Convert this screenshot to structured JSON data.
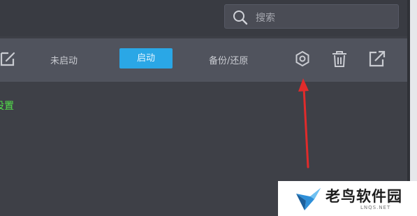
{
  "search": {
    "placeholder": "搜索"
  },
  "toolbar": {
    "edit_icon": "edit-icon",
    "not_started_label": "未启动",
    "start_label": "启动",
    "backup_restore_label": "备份/还原",
    "settings_icon": "gear-icon",
    "delete_icon": "trash-icon",
    "export_icon": "share-icon"
  },
  "content": {
    "green_text": "设置"
  },
  "watermark": {
    "title": "老鸟软件园",
    "subtitle": "LNQS.NET"
  },
  "colors": {
    "accent": "#2aa7e6",
    "highlight_green": "#52e04a",
    "annotation_red": "#e02b2b"
  }
}
